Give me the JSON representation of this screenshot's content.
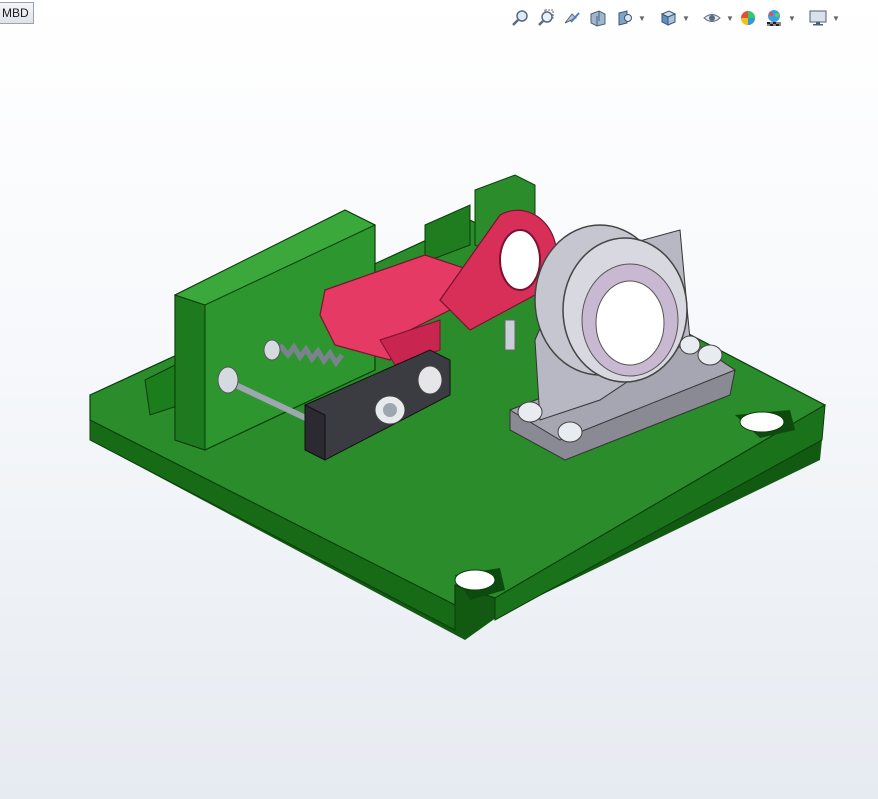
{
  "tab": {
    "label": "MBD"
  },
  "toolbar": {
    "items": [
      {
        "name": "zoom-to-fit-icon"
      },
      {
        "name": "zoom-to-area-icon"
      },
      {
        "name": "previous-view-icon"
      },
      {
        "name": "section-view-icon"
      },
      {
        "name": "dynamic-annotation-icon"
      },
      {
        "name": "view-orientation-icon"
      },
      {
        "name": "display-style-icon"
      },
      {
        "name": "hide-show-items-icon"
      },
      {
        "name": "edit-appearance-icon"
      },
      {
        "name": "apply-scene-icon"
      },
      {
        "name": "view-settings-icon"
      }
    ]
  },
  "colors": {
    "base_plate": "#1f7a1f",
    "rocker_arm": "#e0345d",
    "bearing_block": "#a9a9b5",
    "clamp_block": "#3b3b42"
  }
}
